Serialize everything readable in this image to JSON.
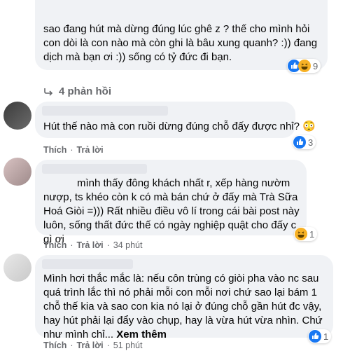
{
  "comments": [
    {
      "text": "sao đang hút mà dừng đúng lúc ghê z ? thế cho mình hỏi con dòi là con nào mà còn ghi là bâu xung quanh? :)) đang dịch mà bạn ơi :)) sống có tỷ đức đi bạn.",
      "reactions": {
        "icons": [
          "like-icon",
          "haha-icon"
        ],
        "count": "9"
      },
      "replies_label": "4 phản hồi"
    },
    {
      "text": "Hút thế nào mà con ruồi dừng đúng chỗ đấy được nhỉ? 😳",
      "reactions": {
        "icons": [
          "like-icon"
        ],
        "count": "3"
      },
      "actions": {
        "like": "Thích",
        "reply": "Trả lời"
      }
    },
    {
      "text_partial": "mình thấy đông khách nhất r, xếp hàng nườm nượp, ts khéo còn k có mà bán chứ ở đấy mà Trà Sữa Hoá Giòi =))) Rất nhiều điều vô lí trong cái bài post này luôn, sống thất đức thế có ngày nghiệp quật cho đấy c gì ơi",
      "reactions": {
        "icons": [
          "haha-icon"
        ],
        "count": "1"
      },
      "actions": {
        "like": "Thích",
        "reply": "Trả lời",
        "time": "34 phút"
      }
    },
    {
      "text": "Mình hơi thắc mắc là: nếu côn trùng có giòi pha vào nc sau quá trình lắc thì nó phải mỗi con mỗi nơi chứ sao lại bám 1 chỗ thế kia và sao con kia nó lại ở đúng chỗ gần hút đc vậy, hay hút phải lại đẩy vào chụp, hay là vừa hút vừa nhìn. Chứ như mình chỉ...",
      "see_more": "Xem thêm",
      "reactions": {
        "icons": [
          "like-icon"
        ],
        "count": "1"
      },
      "actions": {
        "like": "Thích",
        "reply": "Trả lời",
        "time": "51 phút"
      }
    }
  ],
  "colors": {
    "bubble": "#f0f2f5",
    "like": "#1877f2",
    "haha": "#f7b125",
    "meta": "#65676b"
  }
}
